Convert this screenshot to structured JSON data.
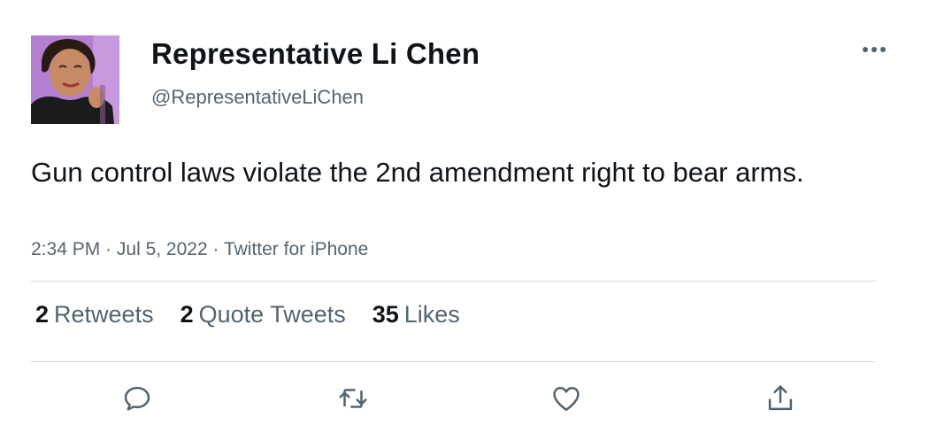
{
  "author": {
    "display_name": "Representative Li Chen",
    "handle": "@RepresentativeLiChen"
  },
  "tweet": {
    "text": "Gun control laws violate the 2nd amendment right to bear arms.",
    "time": "2:34 PM",
    "date": "Jul 5, 2022",
    "source": "Twitter for iPhone",
    "separator": " · "
  },
  "stats": {
    "retweets": {
      "count": "2",
      "label": "Retweets"
    },
    "quotes": {
      "count": "2",
      "label": "Quote Tweets"
    },
    "likes": {
      "count": "35",
      "label": "Likes"
    }
  },
  "actions": [
    "reply-icon",
    "retweet-icon",
    "like-icon",
    "share-icon"
  ],
  "colors": {
    "text_primary": "#0f1419",
    "text_secondary": "#536471",
    "divider": "#cfd9de",
    "icon": "#536471",
    "avatar_background": "#b57fd1"
  }
}
